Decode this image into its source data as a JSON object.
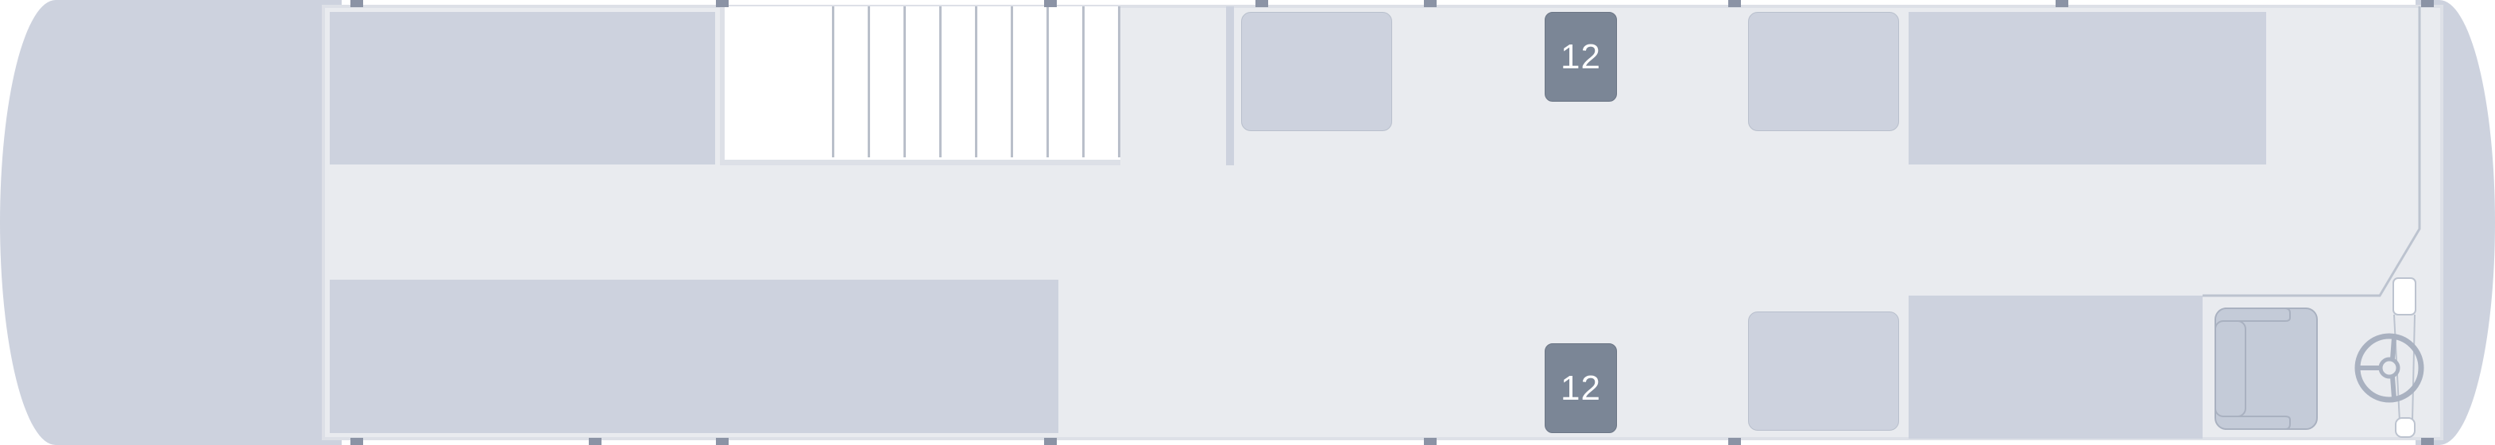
{
  "colors": {
    "body": "#cdd2de",
    "floor": "#e9ebef",
    "seat_available": "#cdd2de",
    "seat_taken": "#7b8696",
    "seat_number_text": "#ffffff",
    "window_marker": "#8b93a5"
  },
  "icons": [
    "steering-wheel-icon",
    "driver-seat-icon"
  ],
  "seats": [
    {
      "label": "",
      "status": "available"
    },
    {
      "label": "12",
      "status": "taken"
    },
    {
      "label": "",
      "status": "available"
    },
    {
      "label": "",
      "status": "available"
    },
    {
      "label": "12",
      "status": "taken"
    }
  ]
}
